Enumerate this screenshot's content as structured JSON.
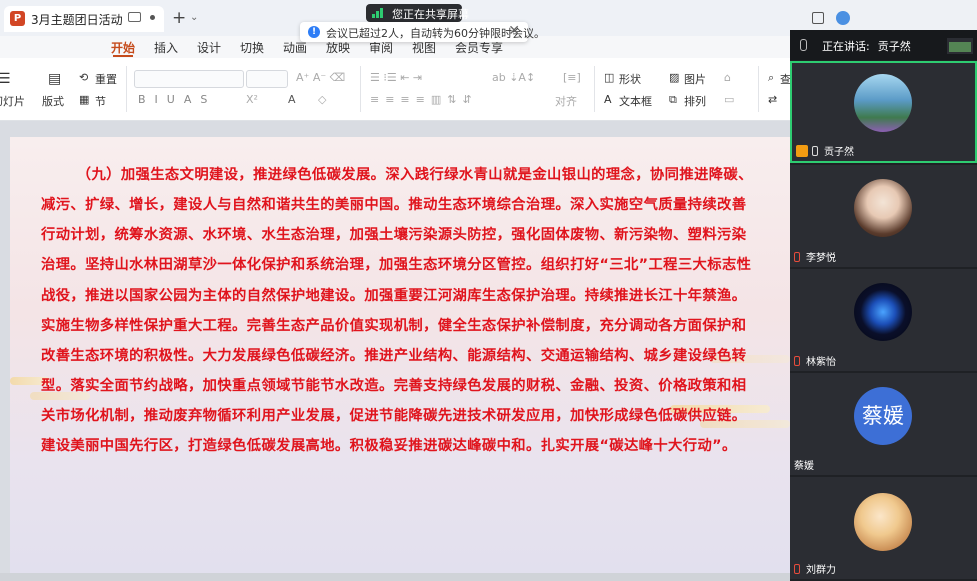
{
  "titlebar": {
    "doc_tab_title": "3月主题团日活动",
    "app_icon_letter": "P"
  },
  "share": {
    "label": "您正在共享屏幕"
  },
  "notice": {
    "text": "会议已超过2人，自动转为60分钟限时会议。",
    "info_glyph": "!",
    "close_glyph": "✕"
  },
  "ribbon": {
    "tabs": [
      "开始",
      "插入",
      "设计",
      "切换",
      "动画",
      "放映",
      "审阅",
      "视图",
      "会员专享"
    ],
    "active_tab": "开始"
  },
  "toolbar": {
    "reset": "重置",
    "slides": "幻灯片",
    "layout": "版式",
    "section": "节",
    "shape": "形状",
    "picture": "图片",
    "textbox": "文本框",
    "arrange": "排列",
    "align": "对齐",
    "find": "查"
  },
  "slide": {
    "paragraph": "（九）加强生态文明建设，推进绿色低碳发展。深入践行绿水青山就是金山银山的理念，协同推进降碳、减污、扩绿、增长，建设人与自然和谐共生的美丽中国。推动生态环境综合治理。深入实施空气质量持续改善行动计划，统筹水资源、水环境、水生态治理，加强土壤污染源头防控，强化固体废物、新污染物、塑料污染治理。坚持山水林田湖草沙一体化保护和系统治理，加强生态环境分区管控。组织打好“三北”工程三大标志性战役，推进以国家公园为主体的自然保护地建设。加强重要江河湖库生态保护治理。持续推进长江十年禁渔。实施生物多样性保护重大工程。完善生态产品价值实现机制，健全生态保护补偿制度，充分调动各方面保护和改善生态环境的积极性。大力发展绿色低碳经济。推进产业结构、能源结构、交通运输结构、城乡建设绿色转型。落实全面节约战略，加快重点领域节能节水改造。完善支持绿色发展的财税、金融、投资、价格政策和相关市场化机制，推动废弃物循环利用产业发展，促进节能降碳先进技术研发应用，加快形成绿色低碳供应链。建设美丽中国先行区，打造绿色低碳发展高地。积极稳妥推进碳达峰碳中和。扎实开展“碳达峰十大行动”。",
    "text_color": "#e0141d"
  },
  "meeting": {
    "speaking_label": "正在讲话:",
    "speaking_name": "贡子然",
    "participants": [
      {
        "name": "贡子然",
        "avatar": "landscape-avatar",
        "host": true,
        "mic": "on"
      },
      {
        "name": "李梦悦",
        "avatar": "girl-avatar",
        "host": false,
        "mic": "off"
      },
      {
        "name": "林紫怡",
        "avatar": "planet-avatar",
        "host": false,
        "mic": "off"
      },
      {
        "name": "蔡媛",
        "avatar_text": "蔡媛",
        "avatar_color": "#3d6fd6",
        "host": false,
        "mic": "none"
      },
      {
        "name": "刘群力",
        "avatar": "anime-avatar",
        "host": false,
        "mic": "off"
      }
    ]
  }
}
